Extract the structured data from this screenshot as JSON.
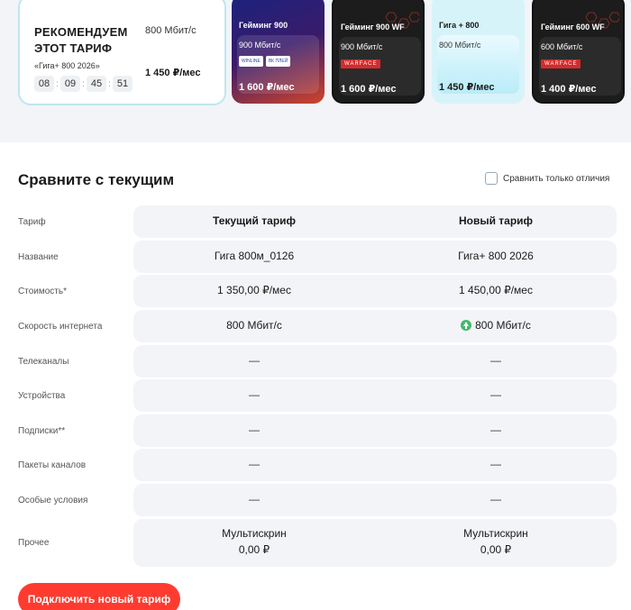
{
  "top": {
    "recommended_card": {
      "title": "РЕКОМЕНДУЕМ ЭТОТ ТАРИФ",
      "tariff_name": "«Гига+ 800 2026»",
      "speed": "800 Мбит/с",
      "price": "1 450 ₽/мес",
      "timer": [
        "08",
        "09",
        "45",
        "51"
      ]
    },
    "promo_cards": [
      {
        "name": "Гейминг 900",
        "speed": "900 Мбит/с",
        "price": "1 600 ₽/мес",
        "logos": [
          "WINLINE",
          "ВК ПЛЕЙ"
        ]
      },
      {
        "name": "Гейминг 900 WF",
        "speed": "900 Мбит/с",
        "price": "1 600 ₽/мес",
        "badge": "WARFACE"
      },
      {
        "name": "Гига + 800",
        "speed": "800 Мбит/с",
        "price": "1 450 ₽/мес"
      },
      {
        "name": "Гейминг 600 WF",
        "speed": "600 Мбит/с",
        "price": "1 400 ₽/мес",
        "badge": "WARFACE"
      }
    ]
  },
  "compare": {
    "title": "Сравните с текущим",
    "diff_only_label": "Сравнить только отличия",
    "header": {
      "label": "Тариф",
      "current": "Текущий тариф",
      "new": "Новый тариф"
    },
    "rows": [
      {
        "label": "Название",
        "current": "Гига 800м_0126",
        "new": "Гига+ 800 2026"
      },
      {
        "label": "Стоимость*",
        "current": "1 350,00 ₽/мес",
        "new": "1 450,00 ₽/мес"
      },
      {
        "label": "Скорость интернета",
        "current": "800 Мбит/с",
        "new": "800 Мбит/с"
      },
      {
        "label": "Телеканалы",
        "current": "—",
        "new": "—"
      },
      {
        "label": "Устройства",
        "current": "—",
        "new": "—"
      },
      {
        "label": "Подписки**",
        "current": "—",
        "new": "—"
      },
      {
        "label": "Пакеты каналов",
        "current": "—",
        "new": "—"
      },
      {
        "label": "Особые условия",
        "current": "—",
        "new": "—"
      }
    ],
    "other": {
      "label": "Прочее",
      "current_line1": "Мультискрин",
      "current_line2": "0,00 ₽",
      "new_line1": "Мультискрин",
      "new_line2": "0,00 ₽"
    }
  },
  "connect_button": "Подключить новый тариф",
  "colors": {
    "accent": "#ff3b30",
    "row_bg": "#f2f4f7",
    "speed_up": "#44b86b"
  }
}
